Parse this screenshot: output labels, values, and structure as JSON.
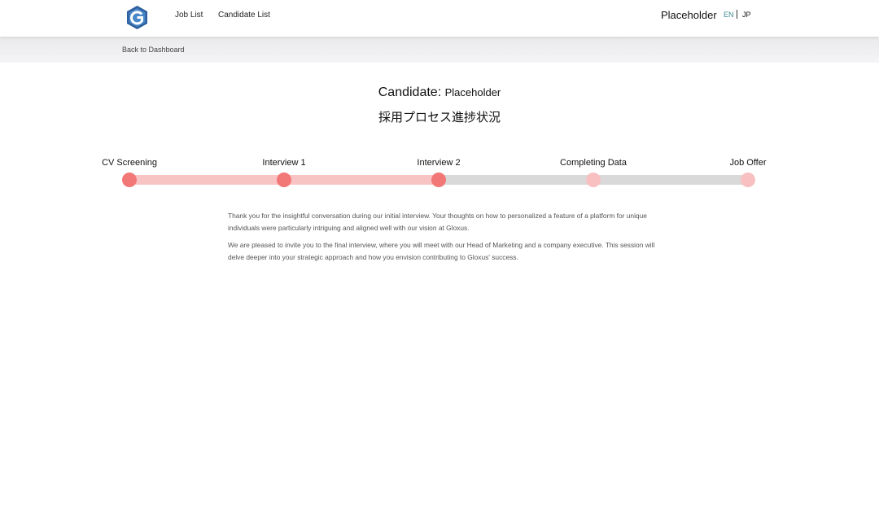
{
  "header": {
    "logo_icon": "gloxus-g-logo-icon",
    "nav": [
      {
        "label": "Job List"
      },
      {
        "label": "Candidate List"
      }
    ],
    "user_name": "Placeholder",
    "languages": [
      {
        "label": "EN",
        "active": true,
        "color": "#3a8a8f"
      },
      {
        "label": "JP",
        "active": false
      }
    ]
  },
  "subheader": {
    "back_label": "Back to Dashboard"
  },
  "candidate": {
    "prefix": "Candidate:",
    "name": "Placeholder",
    "process_title": "採用プロセス進捗状況"
  },
  "progress": {
    "completed_color": "#f27777",
    "pending_color": "#f9c0c2",
    "steps": [
      {
        "label": "CV Screening",
        "status": "completed"
      },
      {
        "label": "Interview 1",
        "status": "completed"
      },
      {
        "label": "Interview 2",
        "status": "current"
      },
      {
        "label": "Completing Data",
        "status": "pending"
      },
      {
        "label": "Job Offer",
        "status": "pending"
      }
    ]
  },
  "message": {
    "paragraphs": [
      "Thank you for the insightful conversation during our initial interview. Your thoughts on how to personalized a feature of a platform for unique individuals were particularly intriguing and aligned well with our vision at Gloxus.",
      "We are pleased to invite you to the final interview, where you will meet with our Head of Marketing and a company executive. This session will delve deeper into your strategic approach and how you envision contributing to Gloxus' success."
    ]
  }
}
